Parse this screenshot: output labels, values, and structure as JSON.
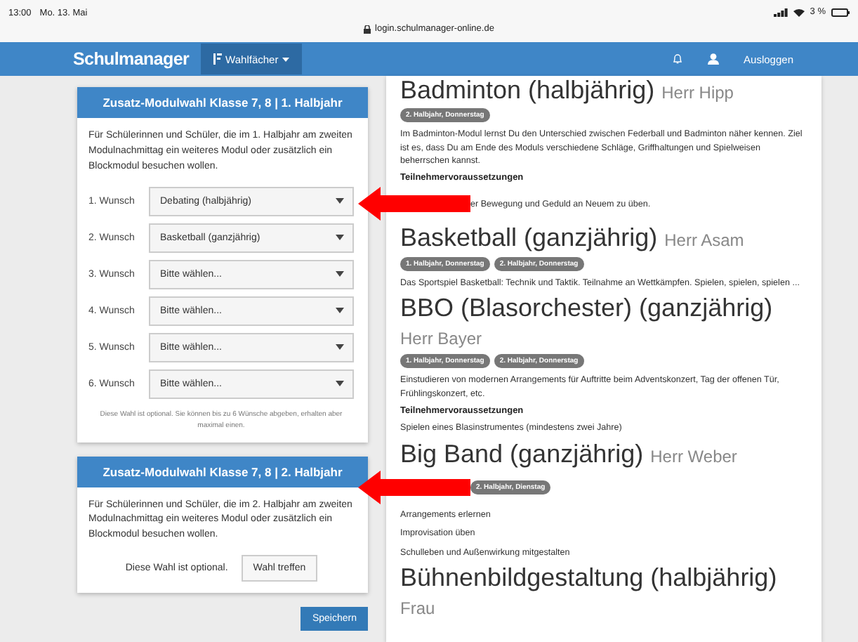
{
  "status_bar": {
    "time": "13:00",
    "date": "Mo. 13. Mai",
    "url": "login.schulmanager-online.de",
    "battery": "3 %"
  },
  "navbar": {
    "logo": "Schulmanager",
    "menu": "Wahlfächer",
    "logout": "Ausloggen"
  },
  "panels": [
    {
      "kind": "wishes",
      "title": "Zusatz-Modulwahl Klasse 7, 8 | 1. Halbjahr",
      "intro": "Für Schülerinnen und Schüler, die im 1. Halbjahr am zweiten Modulnachmittag ein weiteres Modul oder zusätzlich ein Blockmodul besuchen wollen.",
      "wishes": [
        {
          "label": "1. Wunsch",
          "value": "Debating (halbjährig)"
        },
        {
          "label": "2. Wunsch",
          "value": "Basketball (ganzjährig)"
        },
        {
          "label": "3. Wunsch",
          "value": "Bitte wählen..."
        },
        {
          "label": "4. Wunsch",
          "value": "Bitte wählen..."
        },
        {
          "label": "5. Wunsch",
          "value": "Bitte wählen..."
        },
        {
          "label": "6. Wunsch",
          "value": "Bitte wählen..."
        }
      ],
      "note": "Diese Wahl ist optional. Sie können bis zu 6 Wünsche abgeben, erhalten aber maximal einen."
    },
    {
      "kind": "optional",
      "title": "Zusatz-Modulwahl Klasse 7, 8 | 2. Halbjahr",
      "intro": "Für Schülerinnen und Schüler, die im 2. Halbjahr am zweiten Modulnachmittag ein weiteres Modul oder zusätzlich ein Blockmodul besuchen wollen.",
      "note": "Diese Wahl ist optional.",
      "button": "Wahl treffen"
    }
  ],
  "save_button": "Speichern",
  "modules": [
    {
      "title": "Badminton (halbjährig)",
      "teacher": "Herr Hipp",
      "badges": [
        "2. Halbjahr, Donnerstag"
      ],
      "description": [
        "Im Badminton-Modul lernst Du den Unterschied zwischen Federball und Badminton näher kennen. Ziel ist es, dass Du am Ende des Moduls verschiedene Schläge, Griffhaltungen und Spielweisen beherrschen kannst."
      ],
      "requirements_heading": "Teilnehmervoraussetzungen",
      "requirements": [
        "er Bewegung und Geduld an Neuem zu üben."
      ]
    },
    {
      "title": "Basketball (ganzjährig)",
      "teacher": "Herr Asam",
      "badges": [
        "1. Halbjahr, Donnerstag",
        "2. Halbjahr, Donnerstag"
      ],
      "description": [
        "Das Sportspiel Basketball: Technik und Taktik. Teilnahme an Wettkämpfen. Spielen, spielen, spielen ..."
      ]
    },
    {
      "title": "BBO (Blasorchester) (ganzjährig)",
      "teacher": "Herr Bayer",
      "badges": [
        "1. Halbjahr, Donnerstag",
        "2. Halbjahr, Donnerstag"
      ],
      "description": [
        "Einstudieren von modernen Arrangements für Auftritte beim Adventskonzert, Tag der offenen Tür, Frühlingskonzert, etc."
      ],
      "requirements_heading": "Teilnehmervoraussetzungen",
      "requirements": [
        "Spielen eines Blasinstrumentes (mindestens zwei Jahre)"
      ]
    },
    {
      "title": "Big Band (ganzjährig)",
      "teacher": "Herr Weber",
      "badges": [
        "2. Halbjahr, Dienstag"
      ],
      "description": [
        "Arrangements erlernen",
        "Improvisation üben",
        "Schulleben und Außenwirkung mitgestalten"
      ]
    },
    {
      "title": "Bühnenbildgestaltung (halbjährig)",
      "teacher": "Frau"
    }
  ]
}
